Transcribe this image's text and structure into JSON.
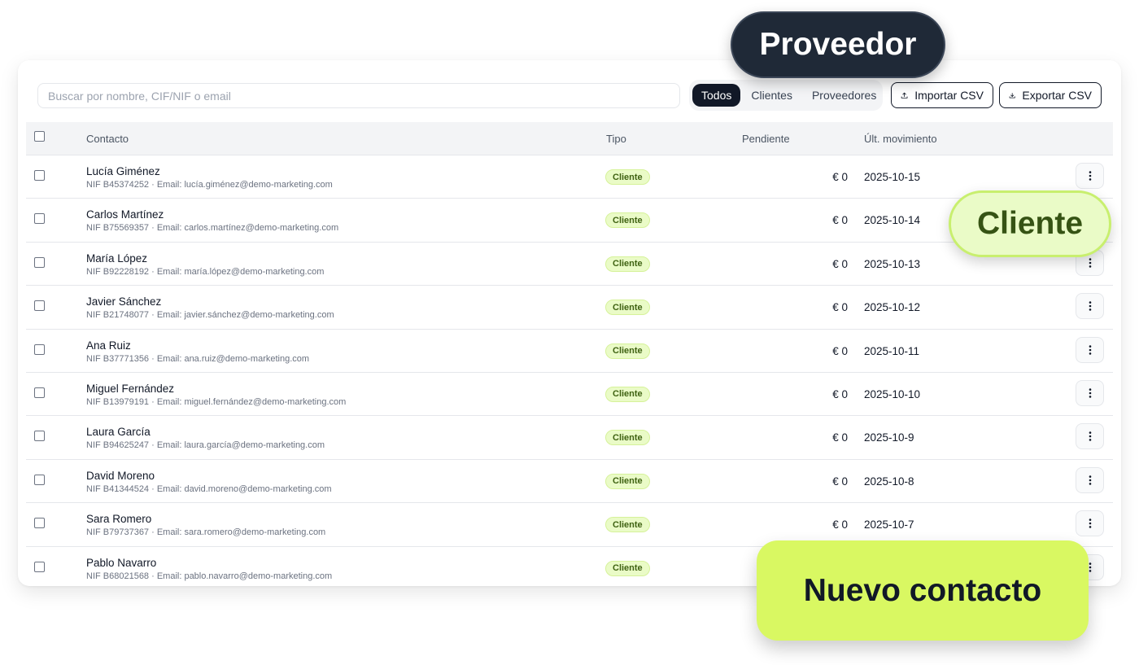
{
  "search": {
    "placeholder": "Buscar por nombre, CIF/NIF o email"
  },
  "filters": [
    {
      "label": "Todos",
      "active": true
    },
    {
      "label": "Clientes",
      "active": false
    },
    {
      "label": "Proveedores",
      "active": false
    }
  ],
  "actions": {
    "import_label": "Importar CSV",
    "import_icon": "upload-icon",
    "export_label": "Exportar CSV",
    "export_icon": "download-icon"
  },
  "table": {
    "headers": {
      "contact": "Contacto",
      "type": "Tipo",
      "pending": "Pendiente",
      "last_movement": "Últ. movimiento"
    },
    "rows": [
      {
        "name": "Lucía Giménez",
        "detail": "NIF B45374252 · Email: lucía.giménez@demo-marketing.com",
        "type": "Cliente",
        "pending": "€ 0",
        "date": "2025-10-15"
      },
      {
        "name": "Carlos Martínez",
        "detail": "NIF B75569357 · Email: carlos.martínez@demo-marketing.com",
        "type": "Cliente",
        "pending": "€ 0",
        "date": "2025-10-14"
      },
      {
        "name": "María López",
        "detail": "NIF B92228192 · Email: maría.lópez@demo-marketing.com",
        "type": "Cliente",
        "pending": "€ 0",
        "date": "2025-10-13"
      },
      {
        "name": "Javier Sánchez",
        "detail": "NIF B21748077 · Email: javier.sánchez@demo-marketing.com",
        "type": "Cliente",
        "pending": "€ 0",
        "date": "2025-10-12"
      },
      {
        "name": "Ana Ruiz",
        "detail": "NIF B37771356 · Email: ana.ruiz@demo-marketing.com",
        "type": "Cliente",
        "pending": "€ 0",
        "date": "2025-10-11"
      },
      {
        "name": "Miguel Fernández",
        "detail": "NIF B13979191 · Email: miguel.fernández@demo-marketing.com",
        "type": "Cliente",
        "pending": "€ 0",
        "date": "2025-10-10"
      },
      {
        "name": "Laura García",
        "detail": "NIF B94625247 · Email: laura.garcía@demo-marketing.com",
        "type": "Cliente",
        "pending": "€ 0",
        "date": "2025-10-9"
      },
      {
        "name": "David Moreno",
        "detail": "NIF B41344524 · Email: david.moreno@demo-marketing.com",
        "type": "Cliente",
        "pending": "€ 0",
        "date": "2025-10-8"
      },
      {
        "name": "Sara Romero",
        "detail": "NIF B79737367 · Email: sara.romero@demo-marketing.com",
        "type": "Cliente",
        "pending": "€ 0",
        "date": "2025-10-7"
      },
      {
        "name": "Pablo Navarro",
        "detail": "NIF B68021568 · Email: pablo.navarro@demo-marketing.com",
        "type": "Cliente",
        "pending": "",
        "date": ""
      }
    ]
  },
  "overlays": {
    "proveedor": "Proveedor",
    "cliente": "Cliente",
    "nuevo_contacto": "Nuevo contacto"
  },
  "colors": {
    "accent_lime": "#d9f862",
    "badge_bg": "#eafbc7",
    "dark": "#111827"
  }
}
